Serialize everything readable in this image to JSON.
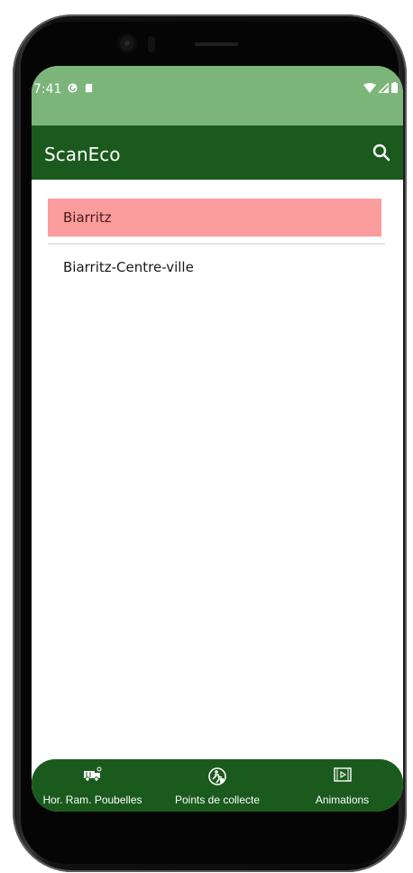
{
  "status_bar": {
    "time": "7:41"
  },
  "app_bar": {
    "title": "ScanEco"
  },
  "list": {
    "items": [
      {
        "label": "Biarritz",
        "selected": true,
        "highlight_color": "#fc9d9d"
      },
      {
        "label": "Biarritz-Centre-ville",
        "selected": false
      }
    ]
  },
  "bottom_nav": {
    "items": [
      {
        "label": "Hor. Ram. Poubelles",
        "icon": "garbage-truck-icon"
      },
      {
        "label": "Points de collecte",
        "icon": "recycle-person-icon"
      },
      {
        "label": "Animations",
        "icon": "video-play-icon"
      }
    ]
  },
  "colors": {
    "status_bar": "#7cb57a",
    "app_bar": "#1b5a1d",
    "fab": "#7b2020",
    "fab_icon": "#4a1010"
  }
}
